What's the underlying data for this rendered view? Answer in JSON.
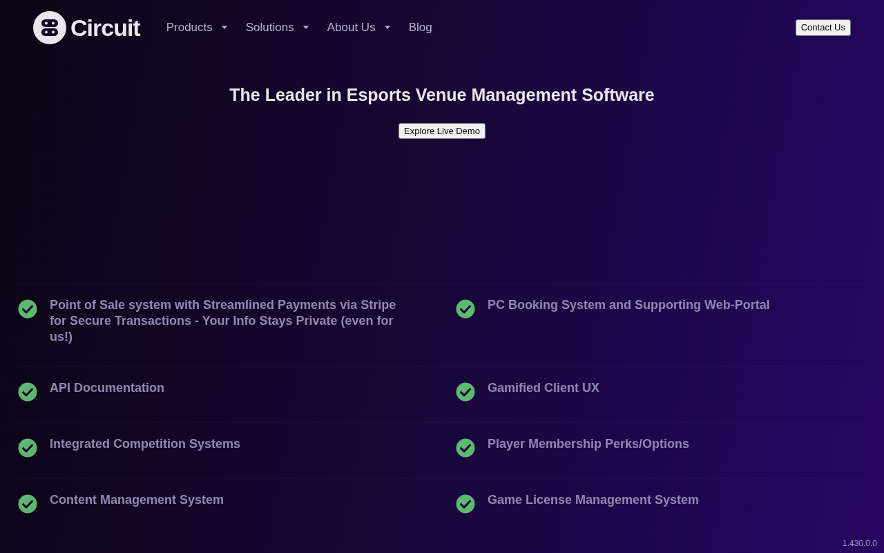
{
  "header": {
    "brand": "Circuit",
    "nav": [
      {
        "label": "Products",
        "has_menu": true
      },
      {
        "label": "Solutions",
        "has_menu": true
      },
      {
        "label": "About Us",
        "has_menu": true
      },
      {
        "label": "Blog",
        "has_menu": false
      }
    ],
    "contact_button": "Contact Us"
  },
  "hero": {
    "title": "The Leader in Esports Venue Management Software",
    "demo_button": "Explore Live Demo"
  },
  "features": [
    {
      "text": "Point of Sale system with Streamlined Payments via Stripe for Secure Transactions - Your Info Stays Private (even for us!)",
      "checked": true
    },
    {
      "text": "PC Booking System and Supporting Web-Portal",
      "checked": true
    },
    {
      "text": "API Documentation",
      "checked": true
    },
    {
      "text": "Gamified Client UX",
      "checked": true
    },
    {
      "text": "Integrated Competition Systems",
      "checked": true
    },
    {
      "text": "Player Membership Perks/Options",
      "checked": true
    },
    {
      "text": "Content Management System",
      "checked": true
    },
    {
      "text": "Game License Management System",
      "checked": true
    }
  ],
  "version": "1.430.0.0"
}
